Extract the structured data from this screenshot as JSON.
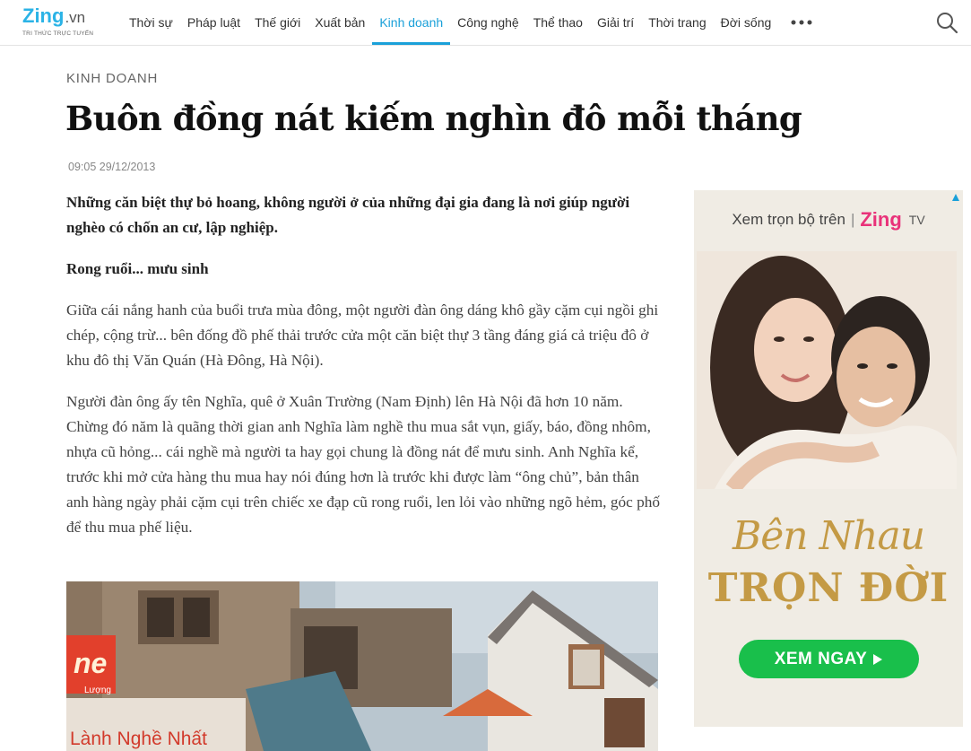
{
  "header": {
    "logo_text": "Zing",
    "logo_suffix": ".vn",
    "logo_tagline": "TRI THỨC TRỰC TUYẾN",
    "nav": [
      "Thời sự",
      "Pháp luật",
      "Thế giới",
      "Xuất bản",
      "Kinh doanh",
      "Công nghệ",
      "Thể thao",
      "Giải trí",
      "Thời trang",
      "Đời sống"
    ],
    "active_nav": "Kinh doanh",
    "more_icon": "ellipsis-icon",
    "search_icon": "search-icon"
  },
  "article": {
    "category": "KINH DOANH",
    "title": "Buôn đồng nát kiếm nghìn đô mỗi tháng",
    "datetime": "09:05 29/12/2013",
    "lead": "Những căn biệt thự bỏ hoang, không người ở của những đại gia đang là nơi giúp người nghèo có chốn an cư, lập nghiệp.",
    "subheading": "Rong ruổi... mưu sinh",
    "paragraphs": [
      "Giữa cái nắng hanh của buổi trưa mùa đông, một người đàn ông dáng khô gầy cặm cụi ngồi ghi chép, cộng trừ... bên đống đồ phế thải trước cửa một căn biệt thự 3 tầng đáng giá cả triệu đô ở khu đô thị Văn Quán (Hà Đông, Hà Nội).",
      "Người đàn ông ấy tên Nghĩa, quê ở Xuân Trường (Nam Định) lên Hà Nội đã hơn 10 năm. Chừng đó năm là quãng thời gian anh Nghĩa làm nghề thu mua sắt vụn, giấy, báo, đồng nhôm, nhựa cũ hỏng... cái nghề mà người ta hay gọi chung là đồng nát để mưu sinh. Anh Nghĩa kể, trước khi mở cửa hàng thu mua hay nói đúng hơn là trước khi được làm “ông chủ”, bản thân anh hàng ngày phải cặm cụi trên chiếc xe đạp cũ rong ruổi, len lỏi vào những ngõ hẻm, góc phố để thu mua phế liệu."
    ],
    "photo_signs": {
      "sign1": "ne",
      "sign1_sub": "Lượng",
      "sign2": "Lành Nghề Nhất"
    }
  },
  "ad": {
    "head_prefix": "Xem trọn bộ trên",
    "head_brand": "Zing",
    "head_suffix": "TV",
    "script_title": "Bên Nhau",
    "big_title": "TRỌN ĐỜI",
    "cta": "XEM NGAY",
    "colors": {
      "gold": "#c49a45",
      "green": "#19bf4b",
      "pink": "#e9327a"
    }
  },
  "colors": {
    "accent": "#1aa0d9"
  }
}
